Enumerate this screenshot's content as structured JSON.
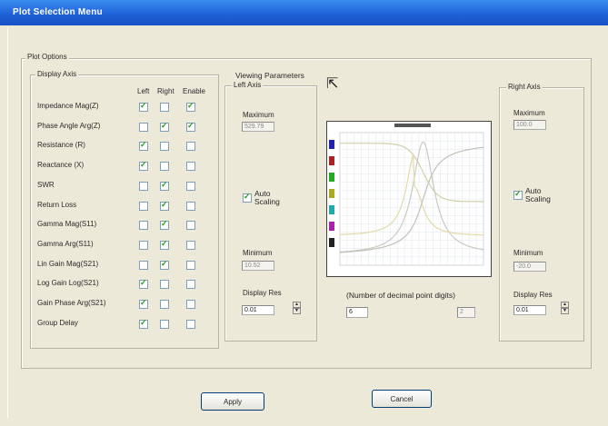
{
  "window": {
    "title": "Plot Selection Menu"
  },
  "plot_options": {
    "label": "Plot Options"
  },
  "display_axis": {
    "label": "Display Axis",
    "headers": [
      "Left",
      "Right",
      "Enable"
    ],
    "rows": [
      {
        "label": "Impedance Mag(Z)",
        "left": true,
        "right": false,
        "enable": true
      },
      {
        "label": "Phase Angle Arg(Z)",
        "left": false,
        "right": true,
        "enable": true
      },
      {
        "label": "Resistance (R)",
        "left": true,
        "right": false,
        "enable": false
      },
      {
        "label": "Reactance (X)",
        "left": true,
        "right": false,
        "enable": false
      },
      {
        "label": "SWR",
        "left": false,
        "right": true,
        "enable": false
      },
      {
        "label": "Return Loss",
        "left": false,
        "right": true,
        "enable": false
      },
      {
        "label": "Gamma Mag(S11)",
        "left": false,
        "right": true,
        "enable": false
      },
      {
        "label": "Gamma Arg(S11)",
        "left": false,
        "right": true,
        "enable": false
      },
      {
        "label": "Lin Gain Mag(S21)",
        "left": false,
        "right": true,
        "enable": false
      },
      {
        "label": "Log Gain Log(S21)",
        "left": true,
        "right": false,
        "enable": false
      },
      {
        "label": "Gain Phase Arg(S21)",
        "left": true,
        "right": false,
        "enable": false
      },
      {
        "label": "Group Delay",
        "left": true,
        "right": false,
        "enable": false
      }
    ]
  },
  "viewing_parameters": {
    "label": "Viewing Parameters"
  },
  "left_axis": {
    "label": "Left Axis",
    "maximum_label": "Maximum",
    "maximum_value": "529.79",
    "auto_label": "Auto\nScaling",
    "auto_checked": true,
    "minimum_label": "Minimum",
    "minimum_value": "10.52",
    "res_label": "Display Res",
    "res_value": "0.01"
  },
  "right_axis": {
    "label": "Right Axis",
    "maximum_label": "Maximum",
    "maximum_value": "100.0",
    "auto_label": "Auto\nScaling",
    "auto_checked": true,
    "minimum_label": "Minimum",
    "minimum_value": "-20.0",
    "res_label": "Display Res",
    "res_value": "0.01"
  },
  "decimal": {
    "label": "(Number of decimal point digits)",
    "left_value": "6",
    "right_value": "2"
  },
  "buttons": {
    "apply": "Apply",
    "cancel": "Cancel"
  },
  "colors": {
    "title_bar": "#2563d8",
    "face": "#ece9d8",
    "check": "#21a121"
  },
  "preview": {
    "legend_swatches": [
      "#2222aa",
      "#aa2222",
      "#22aa22",
      "#aaaa22",
      "#22aaaa",
      "#aa22aa",
      "#222222"
    ]
  }
}
